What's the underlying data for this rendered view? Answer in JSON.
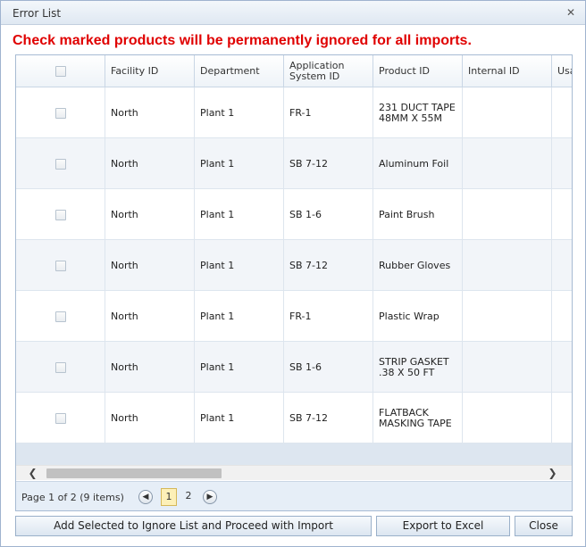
{
  "window": {
    "title": "Error List",
    "close_icon": "close-icon"
  },
  "warning": "Check marked products will be permanently ignored for all imports.",
  "grid": {
    "columns": [
      "Facility ID",
      "Department",
      "Application System ID",
      "Product ID",
      "Internal ID",
      "Usa"
    ],
    "rows": [
      {
        "facility": "North",
        "department": "Plant 1",
        "app_system": "FR-1",
        "product": "231 DUCT TAPE 48MM X 55M",
        "internal": ""
      },
      {
        "facility": "North",
        "department": "Plant 1",
        "app_system": "SB 7-12",
        "product": "Aluminum Foil",
        "internal": ""
      },
      {
        "facility": "North",
        "department": "Plant 1",
        "app_system": "SB 1-6",
        "product": "Paint Brush",
        "internal": ""
      },
      {
        "facility": "North",
        "department": "Plant 1",
        "app_system": "SB 7-12",
        "product": "Rubber Gloves",
        "internal": ""
      },
      {
        "facility": "North",
        "department": "Plant 1",
        "app_system": "FR-1",
        "product": "Plastic Wrap",
        "internal": ""
      },
      {
        "facility": "North",
        "department": "Plant 1",
        "app_system": "SB 1-6",
        "product": "STRIP GASKET .38 X 50 FT",
        "internal": ""
      },
      {
        "facility": "North",
        "department": "Plant 1",
        "app_system": "SB 7-12",
        "product": "FLATBACK MASKING TAPE",
        "internal": ""
      }
    ]
  },
  "pager": {
    "info": "Page 1 of 2 (9 items)",
    "prev_icon": "◀",
    "next_icon": "▶",
    "pages": [
      "1",
      "2"
    ],
    "current_page": "1"
  },
  "scroll": {
    "left_icon": "❮",
    "right_icon": "❯"
  },
  "buttons": {
    "ignore": "Add Selected to Ignore List and Proceed with Import",
    "export": "Export to Excel",
    "close": "Close"
  },
  "colors": {
    "warning": "#e00000",
    "accent": "#dde6f0",
    "current_page": "#fdf0b8"
  }
}
